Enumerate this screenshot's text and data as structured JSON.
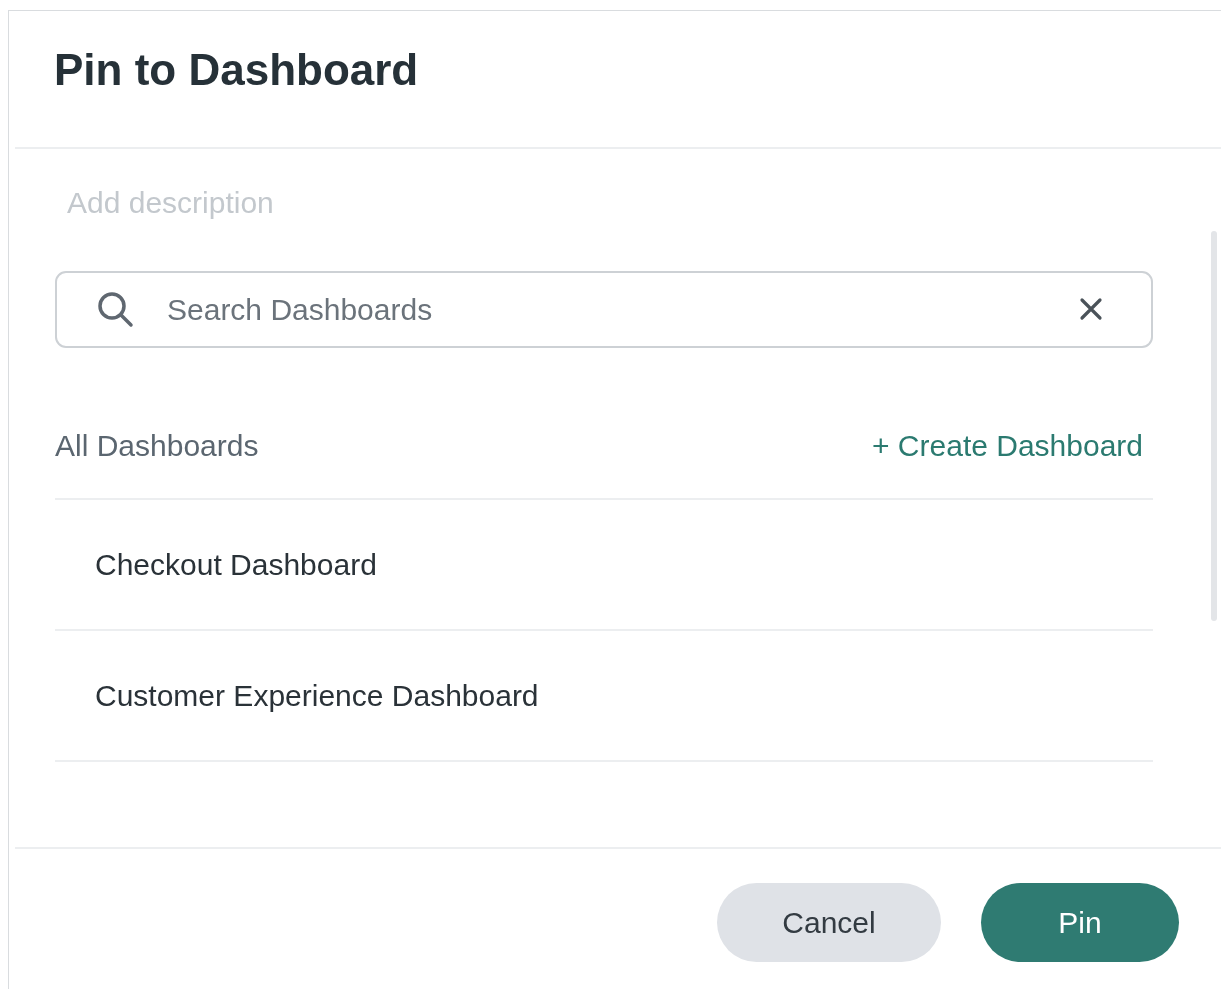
{
  "dialog": {
    "title": "Pin to Dashboard"
  },
  "description": {
    "placeholder": "Add description"
  },
  "search": {
    "placeholder": "Search Dashboards"
  },
  "list": {
    "heading": "All Dashboards",
    "create_label": "+ Create Dashboard",
    "items": [
      {
        "label": "Checkout Dashboard"
      },
      {
        "label": "Customer Experience Dashboard"
      }
    ]
  },
  "buttons": [
    {
      "label": "Cancel",
      "kind": "secondary"
    },
    {
      "label": "Pin",
      "kind": "primary"
    }
  ]
}
